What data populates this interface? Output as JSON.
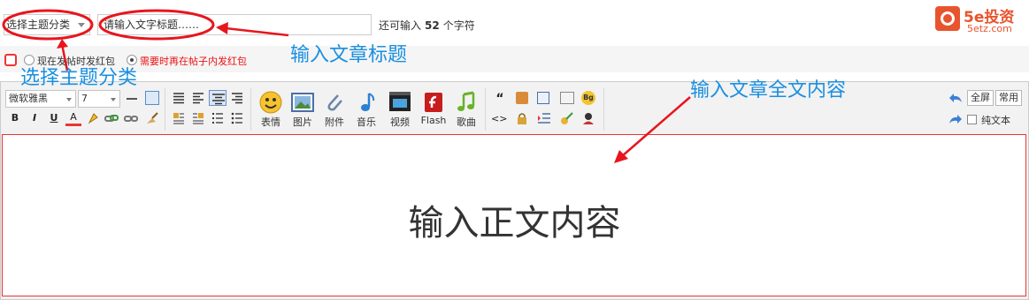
{
  "form": {
    "category_select": "选择主题分类",
    "title_placeholder": "请输入文字标题……",
    "remaining_prefix": "还可输入",
    "remaining_count": "52",
    "remaining_suffix": "个字符"
  },
  "logo": {
    "name": "5e投资",
    "url": "5etz.com"
  },
  "red_packet": {
    "option_now": "现在发帖时发红包",
    "option_later": "需要时再在帖子内发红包",
    "selected": "later"
  },
  "toolbar": {
    "font_family": "微软雅黑",
    "font_size": "7",
    "bold": "B",
    "italic": "I",
    "underline": "U",
    "font_color": "A",
    "media_buttons": [
      "表情",
      "图片",
      "附件",
      "音乐",
      "视频",
      "Flash",
      "歌曲"
    ],
    "fullscreen": "全屏",
    "common": "常用",
    "plain_text": "纯文本",
    "quote": "“",
    "code": "<>"
  },
  "content": {
    "placeholder_text": "输入正文内容"
  },
  "annotations": {
    "select_category": "选择主题分类",
    "input_title": "输入文章标题",
    "input_body": "输入文章全文内容"
  },
  "colors": {
    "annotation": "#1a8fe0",
    "arrow": "#e8151d",
    "brand": "#e8542d"
  }
}
